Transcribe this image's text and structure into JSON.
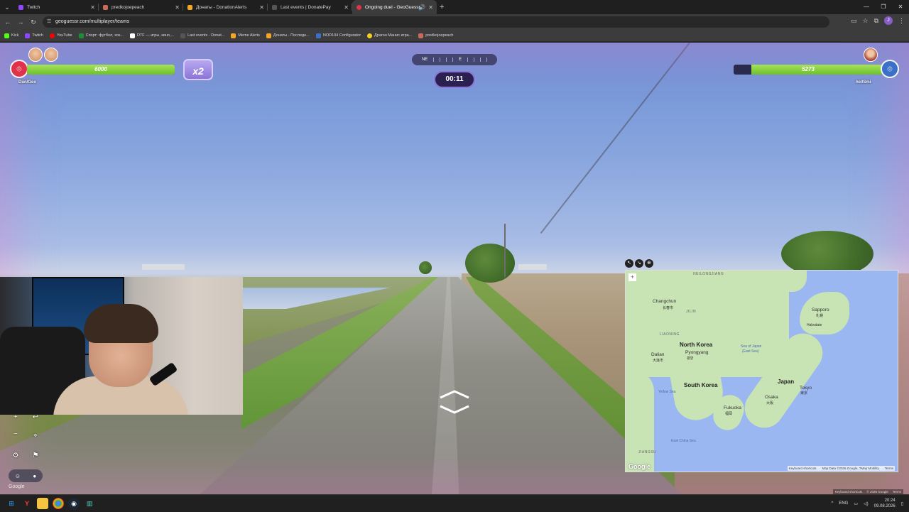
{
  "browser": {
    "tabs": [
      {
        "title": "Twitch",
        "color": "#9146ff"
      },
      {
        "title": "predkojoepeach",
        "color": "#c96b5b"
      },
      {
        "title": "Донаты - DonationAlerts",
        "color": "#f5a623"
      },
      {
        "title": "Last events | DonatePay",
        "color": "#444444"
      },
      {
        "title": "Ongoing duel - GeoGuessr",
        "color": "#e0324a",
        "active": true
      }
    ],
    "url": "geoguessr.com/multiplayer/teams",
    "bookmarks": [
      {
        "label": "Kick",
        "color": "#53fc18"
      },
      {
        "label": "Twitch",
        "color": "#9146ff"
      },
      {
        "label": "YouTube",
        "color": "#ff0000"
      },
      {
        "label": "Спорт: футбол, хок...",
        "color": "#1a8f3a"
      },
      {
        "label": "DTF — игры, кино,...",
        "color": "#ffffff"
      },
      {
        "label": "Last events - Donat...",
        "color": "#444444"
      },
      {
        "label": "Meme Alerts",
        "color": "#f5a623"
      },
      {
        "label": "Донаты - Последн...",
        "color": "#f5a623"
      },
      {
        "label": "NOD104 Configurator",
        "color": "#3c70c8"
      },
      {
        "label": "Драгон Манис игра...",
        "color": "#f5d020"
      },
      {
        "label": "predkojoepeach",
        "color": "#c96b5b"
      }
    ],
    "profile_initial": "J"
  },
  "game": {
    "left_team": {
      "hp": "6000",
      "hp_fraction": 1.0,
      "name": "Dun/Geo"
    },
    "right_team": {
      "hp": "5273",
      "hp_fraction": 0.88,
      "name": "hel/Smi"
    },
    "multiplier": "x2",
    "compass": {
      "left": "NE",
      "center": "E"
    },
    "timer": "00:11"
  },
  "map": {
    "labels": {
      "changchun": "Changchun",
      "changchun_local": "长春市",
      "jilin": "JILIN",
      "heilongjiang": "HEILONGJIANG",
      "liaoning": "LIAONING",
      "north_korea": "North Korea",
      "pyongyang": "Pyongyang",
      "pyongyang_local": "평양",
      "dalian": "Dalian",
      "dalian_local": "大连市",
      "south_korea": "South Korea",
      "sea_of_japan": "Sea of Japan",
      "east_sea": "(East Sea)",
      "yellow_sea": "Yellow Sea",
      "east_china_sea": "East China Sea",
      "sapporo": "Sapporo",
      "sapporo_local": "札幌",
      "hakodate": "Hakodate",
      "japan": "Japan",
      "tokyo": "Tokyo",
      "tokyo_local": "東京",
      "osaka": "Osaka",
      "osaka_local": "大阪",
      "fukuoka": "Fukuoka",
      "fukuoka_local": "福岡",
      "jiangsu": "JIANGSU"
    },
    "zoom_in": "+",
    "footer": {
      "shortcuts": "Keyboard shortcuts",
      "data": "Map Data ©2026 Google, TMap Mobility",
      "terms": "Terms"
    },
    "google": "Google"
  },
  "game_footer": {
    "shortcuts": "Keyboard shortcuts",
    "copyright": "© 2026 Google",
    "terms": "Terms"
  },
  "streetview_watermark": "Google",
  "taskbar": {
    "lang": "ENG",
    "time": "20:24",
    "date": "09.08.2026"
  }
}
